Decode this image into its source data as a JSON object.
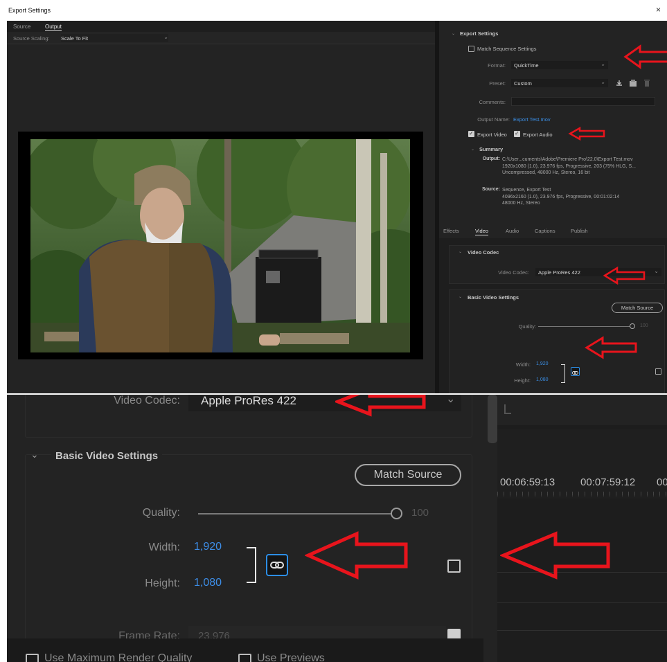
{
  "window": {
    "title": "Export Settings",
    "close_glyph": "×"
  },
  "source_tabs": {
    "source": "Source",
    "output": "Output"
  },
  "source_scaling": {
    "label": "Source Scaling:",
    "value": "Scale To Fit"
  },
  "export_settings": {
    "header": "Export Settings",
    "match_sequence": "Match Sequence Settings",
    "format_label": "Format:",
    "format_value": "QuickTime",
    "preset_label": "Preset:",
    "preset_value": "Custom",
    "comments_label": "Comments:",
    "output_name_label": "Output Name:",
    "output_name_value": "Export Test.mov",
    "export_video": "Export Video",
    "export_audio": "Export Audio",
    "summary_header": "Summary",
    "output_label": "Output:",
    "output_lines": [
      "C:\\User...cuments\\Adobe\\Premiere Pro\\22.0\\Export Test.mov",
      "1920x1080 (1.0), 23.976 fps, Progressive, 203 (75% HLG, S...",
      "Uncompressed, 48000 Hz, Stereo, 16 bit"
    ],
    "source_label": "Source:",
    "source_lines": [
      "Sequence, Export Test",
      "4096x2160 (1.0), 23.976 fps, Progressive, 00:01:02:14",
      "48000 Hz, Stereo"
    ]
  },
  "settings_tabs": [
    "Effects",
    "Video",
    "Audio",
    "Captions",
    "Publish"
  ],
  "video_codec": {
    "header": "Video Codec",
    "label": "Video Codec:",
    "value": "Apple ProRes 422"
  },
  "basic_video": {
    "header": "Basic Video Settings",
    "match_source": "Match Source",
    "quality_label": "Quality:",
    "quality_value": "100",
    "width_label": "Width:",
    "width_value": "1,920",
    "height_label": "Height:",
    "height_value": "1,080",
    "frame_rate_label": "Frame Rate:",
    "frame_rate_value": "23.976"
  },
  "bottom_options": {
    "max_render": "Use Maximum Render Quality",
    "use_previews": "Use Previews"
  },
  "timeline": {
    "times": [
      "00:06:59:13",
      "00:07:59:12",
      "00"
    ]
  },
  "colors": {
    "annotation_red": "#e8141c",
    "link_blue": "#3b8fe6",
    "panel_bg": "#232323"
  },
  "icons": [
    "close-icon",
    "chevron-down-icon",
    "save-preset-icon",
    "import-preset-icon",
    "delete-preset-icon",
    "link-icon",
    "arrow-annotation"
  ]
}
